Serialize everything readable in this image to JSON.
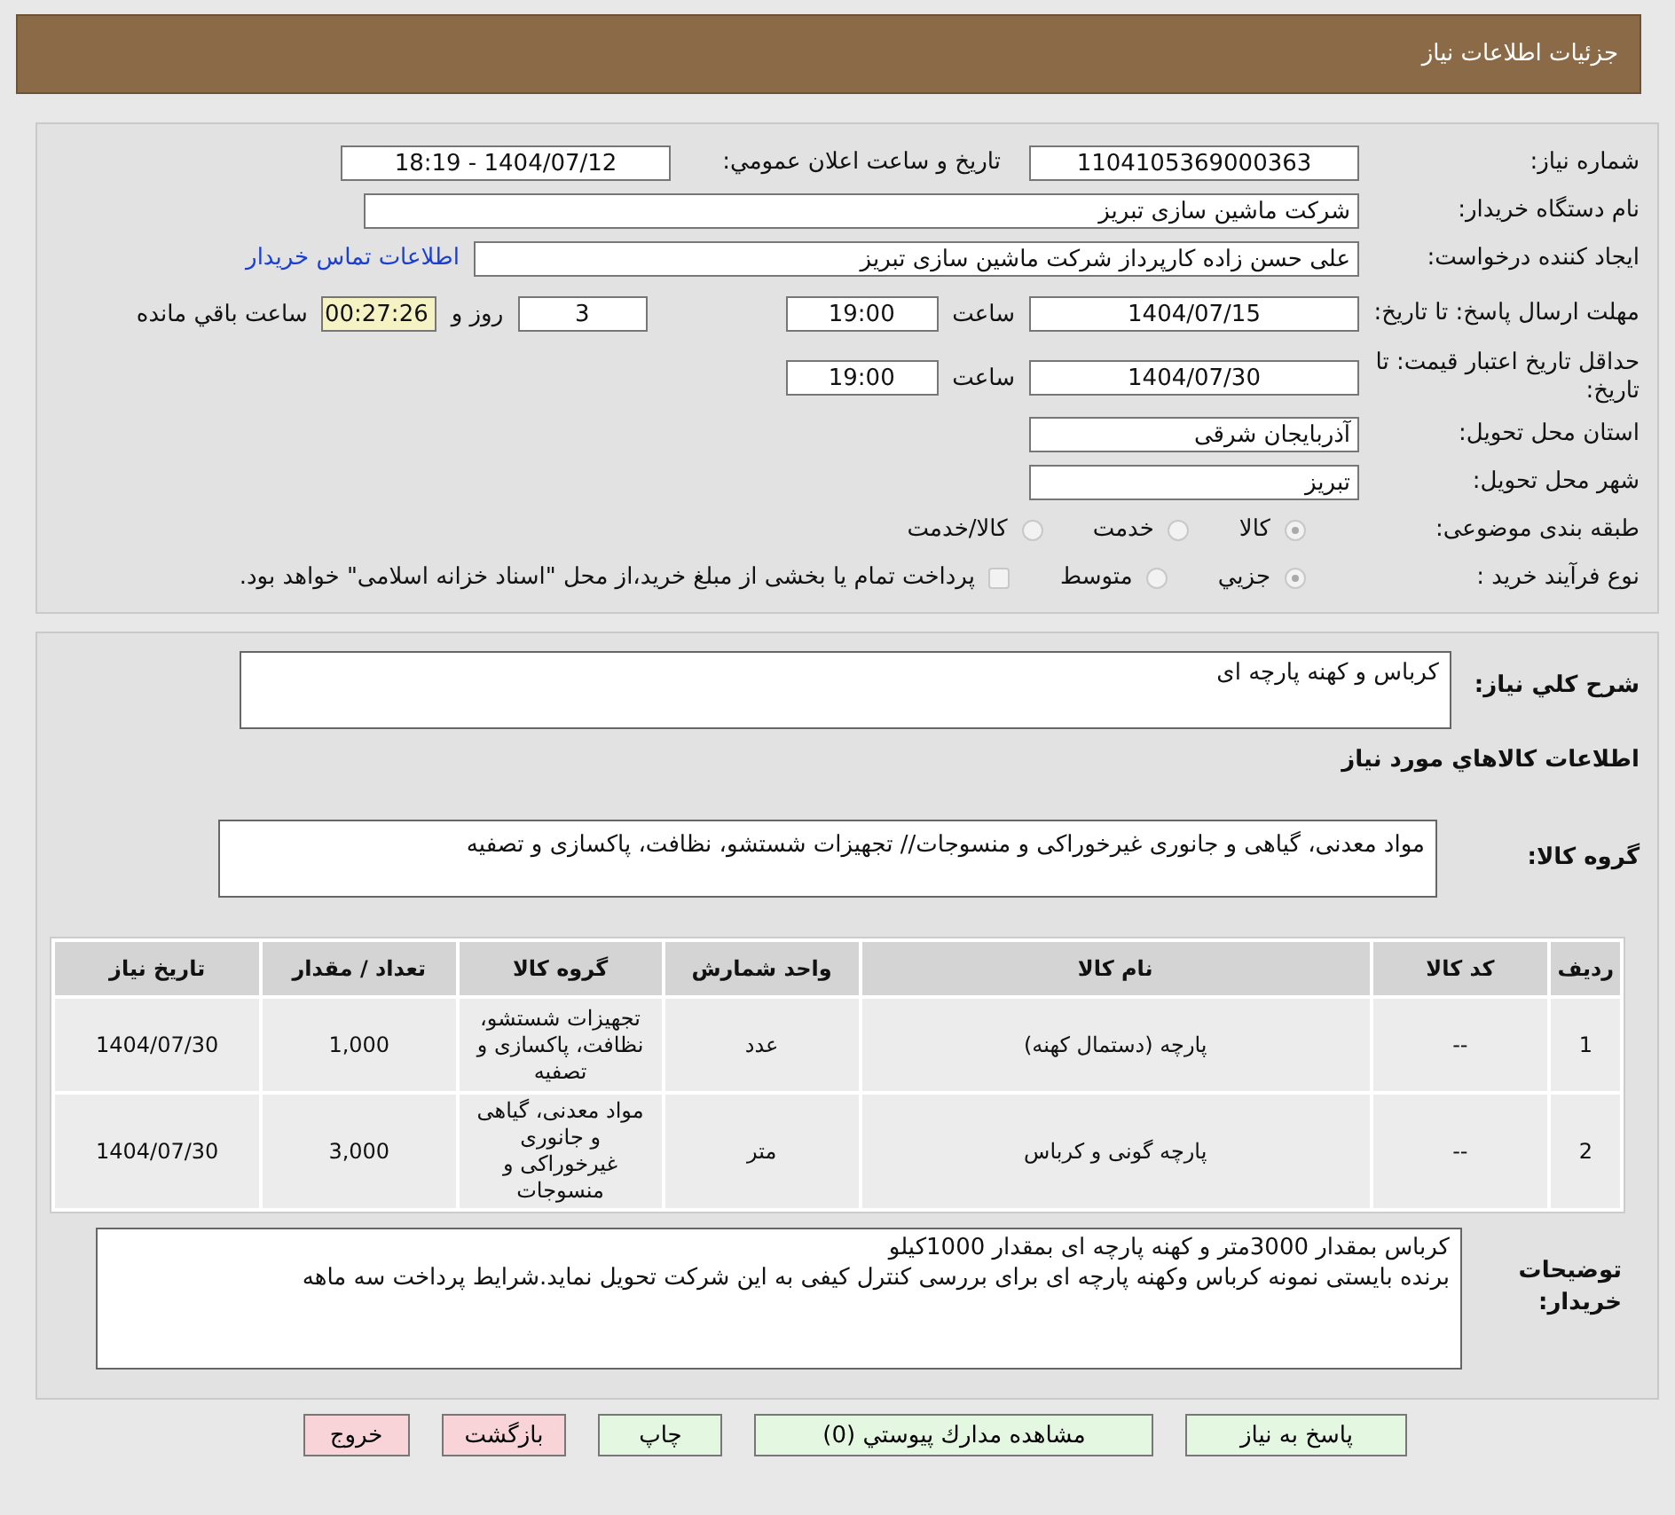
{
  "header": {
    "title": "جزئیات اطلاعات نیاز"
  },
  "details": {
    "need_number": {
      "label": "شماره نیاز:",
      "value": "1104105369000363"
    },
    "announce": {
      "label": "تاريخ و ساعت اعلان عمومي:",
      "value": "1404/07/12 - 18:19"
    },
    "buyer": {
      "label": "نام دستگاه خریدار:",
      "value": "شرکت ماشین سازی تبریز"
    },
    "creator": {
      "label": "ایجاد کننده درخواست:",
      "value": "علی حسن زاده کارپرداز شرکت ماشین سازی تبریز",
      "link": "اطلاعات تماس خریدار"
    },
    "deadline": {
      "label": "مهلت ارسال پاسخ: تا تاریخ:",
      "date": "1404/07/15",
      "time_label": "ساعت",
      "time": "19:00",
      "days": "3",
      "days_label": "روز و",
      "remaining": "00:27:26",
      "remaining_label": "ساعت باقي مانده"
    },
    "validity": {
      "label": "حداقل تاریخ اعتبار قیمت: تا تاریخ:",
      "date": "1404/07/30",
      "time_label": "ساعت",
      "time": "19:00"
    },
    "province": {
      "label": "استان محل تحویل:",
      "value": "آذربایجان شرقی"
    },
    "city": {
      "label": "شهر محل تحویل:",
      "value": "تبریز"
    },
    "category": {
      "label": "طبقه بندی موضوعی:",
      "options": [
        {
          "label": "كالا",
          "selected": true
        },
        {
          "label": "خدمت",
          "selected": false
        },
        {
          "label": "كالا/خدمت",
          "selected": false
        }
      ]
    },
    "process": {
      "label": "نوع فرآیند خرید :",
      "options": [
        {
          "label": "جزيي",
          "selected": true
        },
        {
          "label": "متوسط",
          "selected": false
        }
      ],
      "treasury": {
        "label": "پرداخت تمام یا بخشی از مبلغ خرید،از محل \"اسناد خزانه اسلامی\" خواهد بود.",
        "checked": false
      }
    }
  },
  "goods": {
    "description": {
      "label": "شرح كلي نياز:",
      "value": "کرباس و کهنه پارچه ای"
    },
    "heading": "اطلاعات كالاهاي مورد نياز",
    "group": {
      "label": "گروه کالا:",
      "value": "مواد معدنی، گیاهی و جانوری غیرخوراکی و منسوجات// تجهیزات شستشو، نظافت، پاکسازی و تصفیه"
    },
    "table": {
      "columns": [
        "ردیف",
        "کد کالا",
        "نام کالا",
        "واحد شمارش",
        "گروه کالا",
        "تعداد / مقدار",
        "تاریخ نیاز"
      ],
      "rows": [
        [
          "1",
          "--",
          "پارچه (دستمال کهنه)",
          "عدد",
          "تجهیزات شستشو، نظافت، پاکسازی و تصفیه",
          "1,000",
          "1404/07/30"
        ],
        [
          "2",
          "--",
          "پارچه گونی و کرباس",
          "متر",
          "مواد معدنی، گیاهی و جانوری غیرخوراکی و منسوجات",
          "3,000",
          "1404/07/30"
        ]
      ]
    },
    "notes": {
      "label": "توضیحات خریدار:",
      "lines": [
        "کرباس بمقدار 3000متر و کهنه پارچه ای بمقدار 1000کیلو",
        "برنده بایستی نمونه کرباس وکهنه پارچه ای برای بررسی کنترل کیفی به این شرکت تحویل نماید.شرایط پرداخت سه ماهه"
      ]
    }
  },
  "buttons": [
    {
      "label": "پاسخ به نیاز",
      "kind": "action"
    },
    {
      "label": "مشاهده مدارك پيوستي (0)",
      "kind": "action"
    },
    {
      "label": "چاپ",
      "kind": "action"
    },
    {
      "label": "بازگشت",
      "kind": "nav"
    },
    {
      "label": "خروج",
      "kind": "nav"
    }
  ]
}
